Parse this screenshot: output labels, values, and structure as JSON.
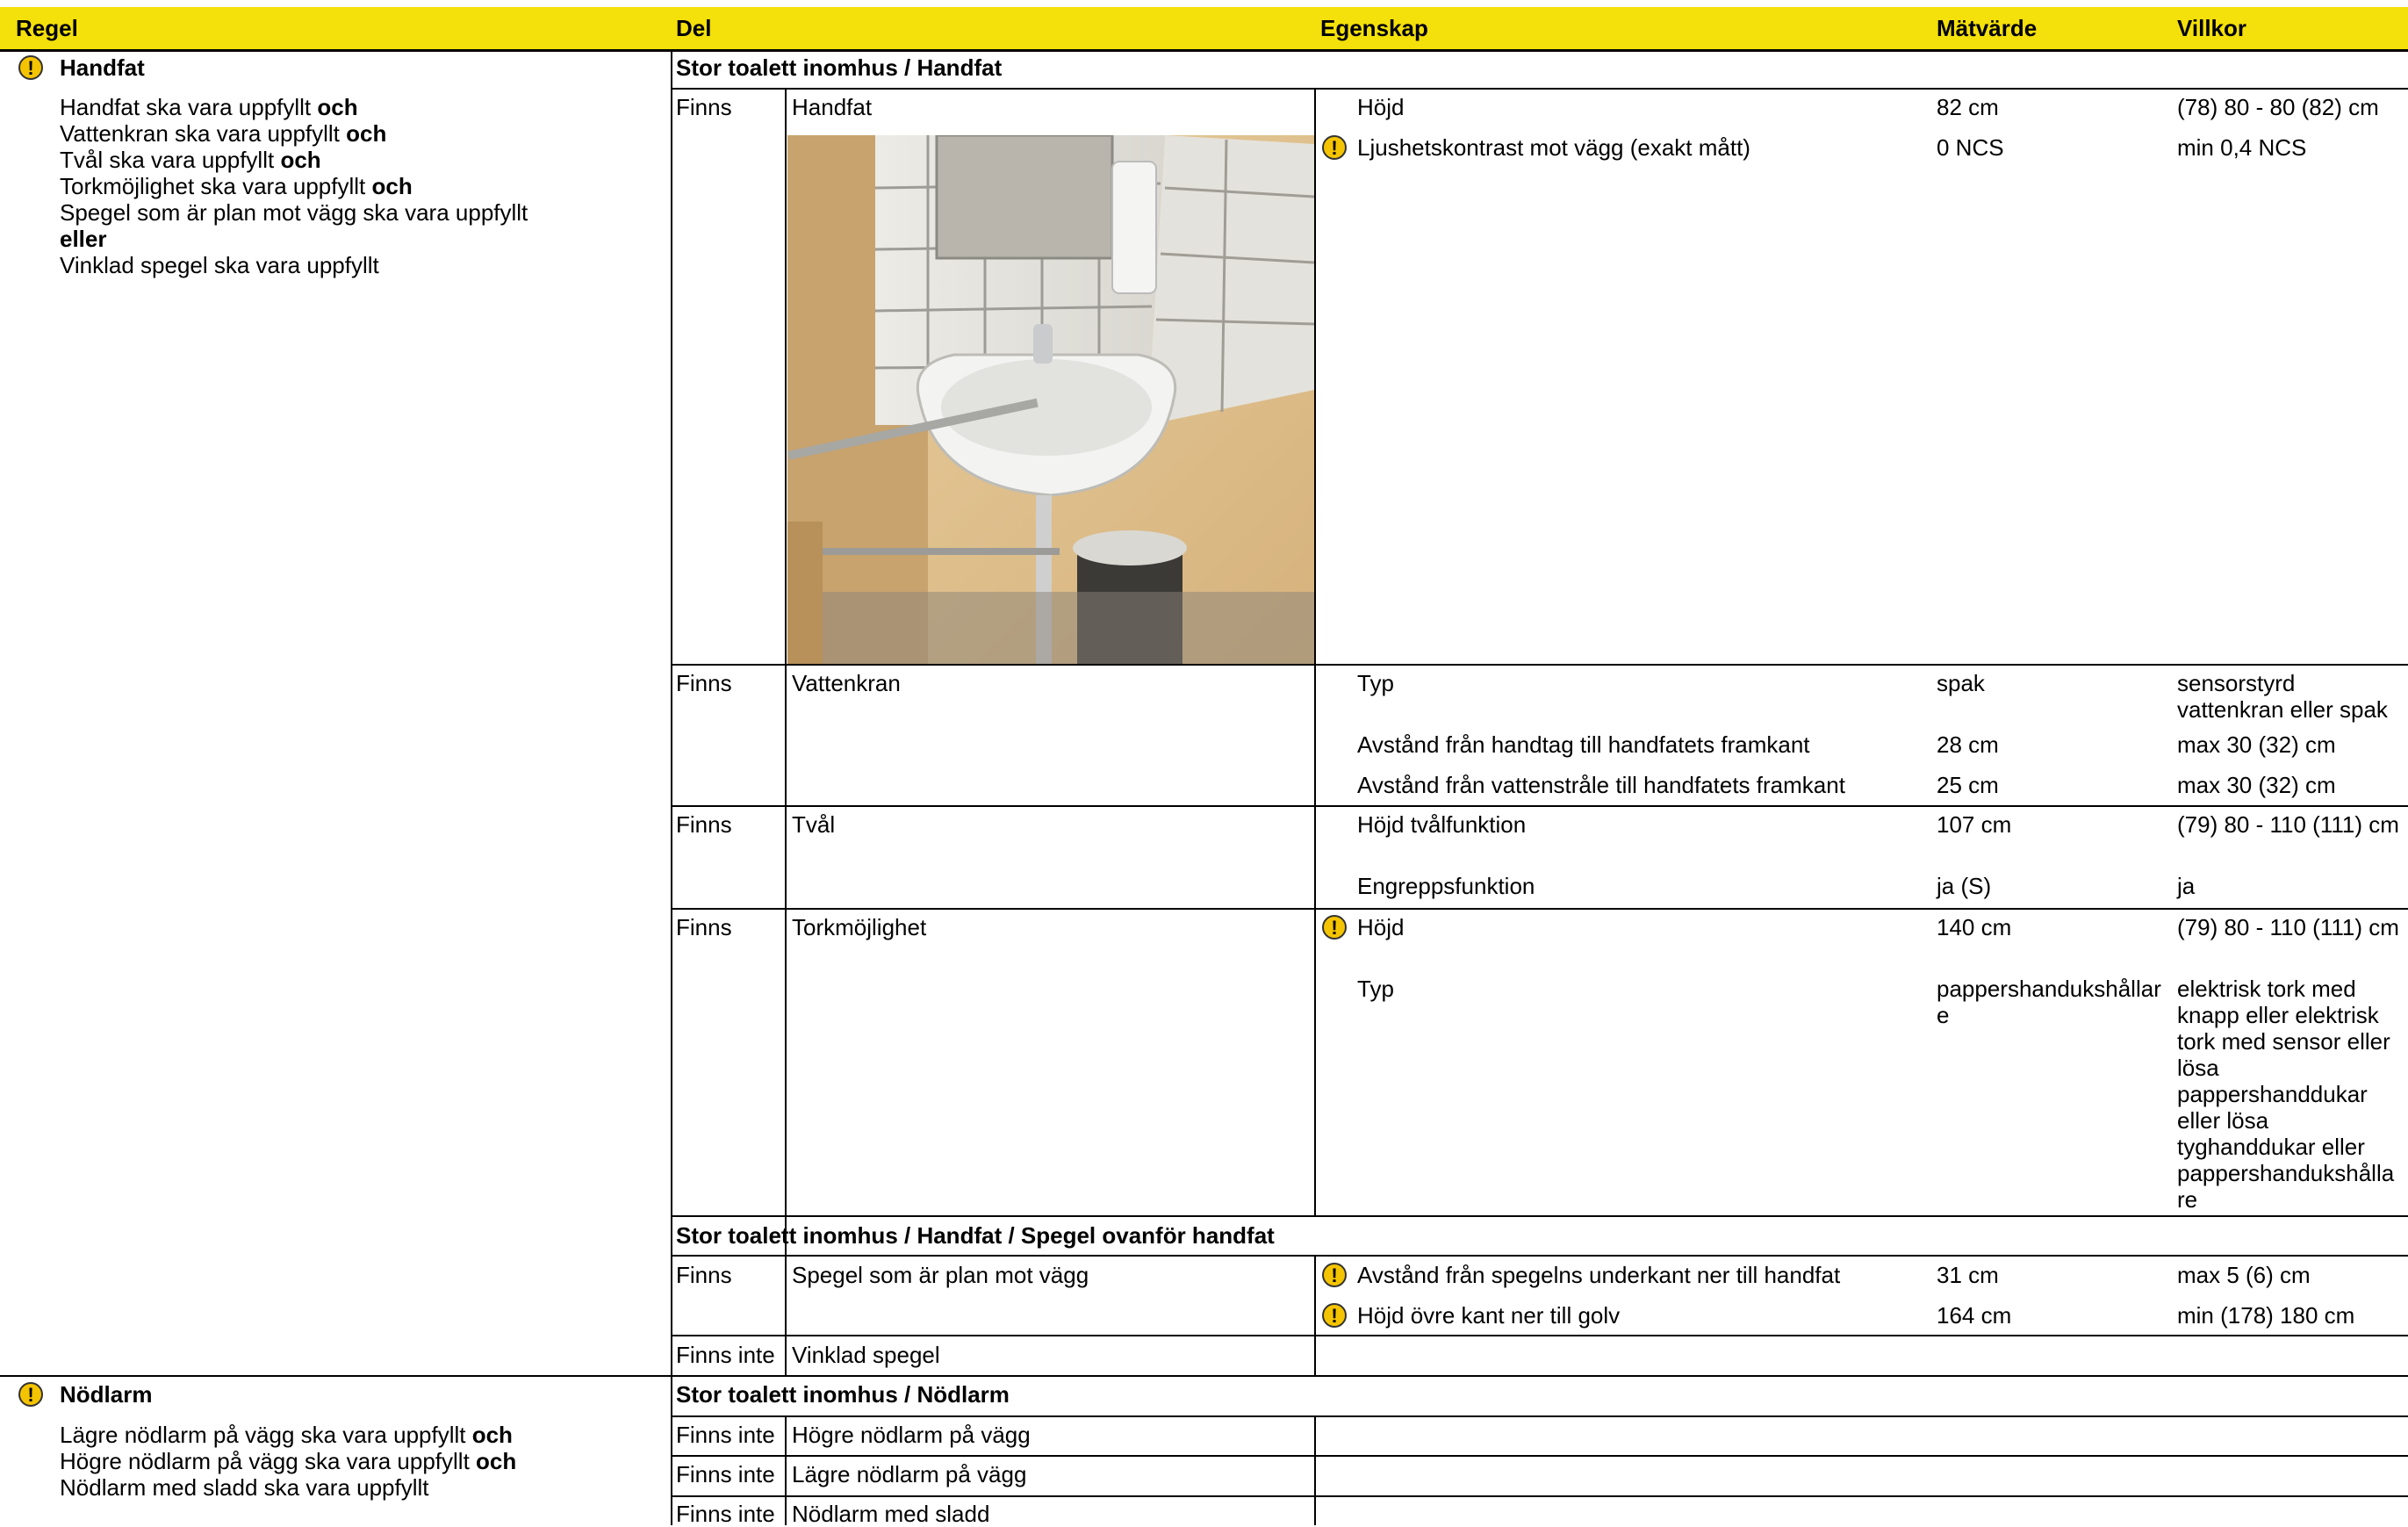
{
  "header": {
    "regel": "Regel",
    "del": "Del",
    "egenskap": "Egenskap",
    "matvarde": "Mätvärde",
    "villkor": "Villkor"
  },
  "rules": [
    {
      "title": "Handfat",
      "lines": [
        {
          "text": "Handfat ska vara uppfyllt ",
          "bold": "och"
        },
        {
          "text": "Vattenkran ska vara uppfyllt ",
          "bold": "och"
        },
        {
          "text": "Tvål ska vara uppfyllt ",
          "bold": "och"
        },
        {
          "text": "Torkmöjlighet ska vara uppfyllt ",
          "bold": "och"
        },
        {
          "text": "Spegel som är plan mot vägg ska vara uppfyllt",
          "bold": ""
        },
        {
          "text": "",
          "bold": "eller"
        },
        {
          "text": "Vinklad spegel ska vara uppfyllt",
          "bold": ""
        }
      ]
    },
    {
      "title": "Nödlarm",
      "lines": [
        {
          "text": "Lägre nödlarm på vägg ska vara uppfyllt ",
          "bold": "och"
        },
        {
          "text": "Högre nödlarm på vägg ska vara uppfyllt ",
          "bold": "och"
        },
        {
          "text": "Nödlarm med sladd ska vara uppfyllt",
          "bold": ""
        }
      ]
    }
  ],
  "sections": {
    "s1": "Stor toalett inomhus / Handfat",
    "s2": "Stor toalett inomhus / Handfat / Spegel ovanför handfat",
    "s3": "Stor toalett inomhus / Nödlarm"
  },
  "rows": {
    "handfat": {
      "status": "Finns",
      "part": "Handfat",
      "props": [
        {
          "name": "Höjd",
          "value": "82 cm",
          "cond": "(78) 80 - 80 (82) cm"
        },
        {
          "name": "Ljushetskontrast mot vägg (exakt mått)",
          "value": "0 NCS",
          "cond": "min 0,4 NCS"
        }
      ]
    },
    "vattenkran": {
      "status": "Finns",
      "part": "Vattenkran",
      "props": [
        {
          "name": "Typ",
          "value": "spak",
          "cond": "sensorstyrd vattenkran eller spak"
        },
        {
          "name": "Avstånd från handtag till handfatets framkant",
          "value": "28 cm",
          "cond": "max 30 (32) cm"
        },
        {
          "name": "Avstånd från vattenstråle till handfatets framkant",
          "value": "25 cm",
          "cond": "max 30 (32) cm"
        }
      ]
    },
    "tval": {
      "status": "Finns",
      "part": "Tvål",
      "props": [
        {
          "name": "Höjd tvålfunktion",
          "value": "107 cm",
          "cond": "(79) 80 - 110 (111) cm"
        },
        {
          "name": "Engreppsfunktion",
          "value": "ja (S)",
          "cond": "ja"
        }
      ]
    },
    "tork": {
      "status": "Finns",
      "part": "Torkmöjlighet",
      "props": [
        {
          "name": "Höjd",
          "value": "140 cm",
          "cond": "(79) 80 - 110 (111) cm"
        },
        {
          "name": "Typ",
          "value": "pappershandukshållar e",
          "cond": "elektrisk tork med knapp eller elektrisk tork med sensor eller lösa pappershanddukar eller lösa tyghanddukar eller pappershandukshålla re"
        }
      ]
    },
    "spegel": {
      "status": "Finns",
      "part": "Spegel som är plan mot vägg",
      "props": [
        {
          "name": "Avstånd från spegelns underkant ner till handfat",
          "value": "31 cm",
          "cond": "max 5 (6) cm"
        },
        {
          "name": "Höjd övre kant ner till golv",
          "value": "164 cm",
          "cond": "min (178) 180 cm"
        }
      ]
    },
    "vinklad": {
      "status": "Finns inte",
      "part": "Vinklad spegel"
    },
    "n1": {
      "status": "Finns inte",
      "part": "Högre nödlarm på vägg"
    },
    "n2": {
      "status": "Finns inte",
      "part": "Lägre nödlarm på vägg"
    },
    "n3": {
      "status": "Finns inte",
      "part": "Nödlarm med sladd"
    }
  },
  "colors": {
    "header_bg": "#f4e00a",
    "warning": "#f5c400"
  }
}
